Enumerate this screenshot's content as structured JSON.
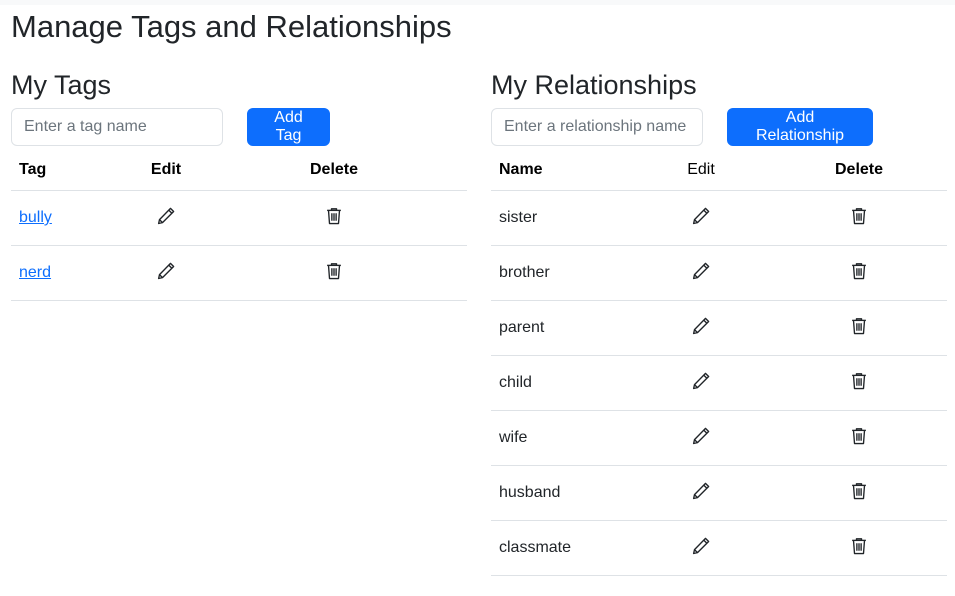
{
  "page": {
    "title": "Manage Tags and Relationships"
  },
  "tags": {
    "heading": "My Tags",
    "input_placeholder": "Enter a tag name",
    "add_button": "Add Tag",
    "columns": [
      "Tag",
      "Edit",
      "Delete"
    ],
    "rows": [
      {
        "name": "bully",
        "edit_icon": "pencil-icon",
        "delete_icon": "trash-icon"
      },
      {
        "name": "nerd",
        "edit_icon": "pencil-icon",
        "delete_icon": "trash-icon"
      }
    ]
  },
  "relationships": {
    "heading": "My Relationships",
    "input_placeholder": "Enter a relationship name",
    "add_button": "Add Relationship",
    "columns": [
      "Name",
      "Edit",
      "Delete"
    ],
    "rows": [
      {
        "name": "sister"
      },
      {
        "name": "brother"
      },
      {
        "name": "parent"
      },
      {
        "name": "child"
      },
      {
        "name": "wife"
      },
      {
        "name": "husband"
      },
      {
        "name": "classmate"
      }
    ]
  },
  "colors": {
    "primary": "#0d6efd",
    "link": "#0d6efd",
    "border": "#dee2e6",
    "text": "#212529"
  }
}
